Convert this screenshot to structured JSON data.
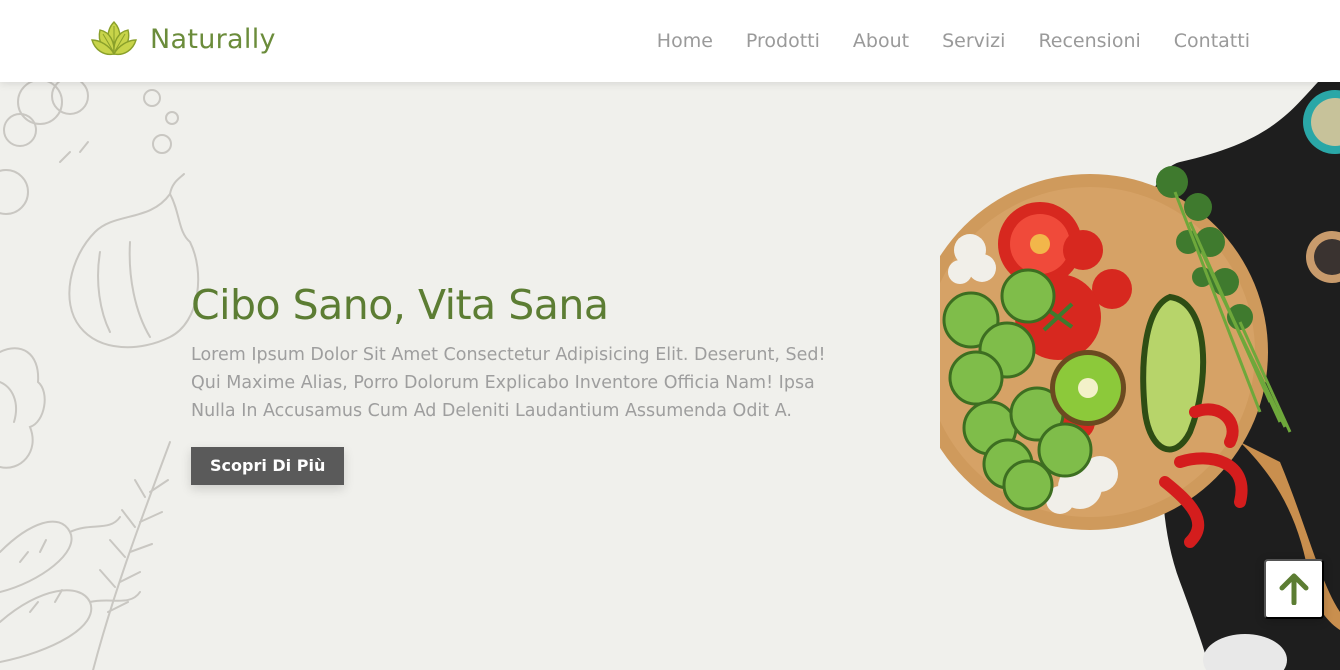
{
  "brand": {
    "name": "Naturally",
    "accent": "#6b8c3b",
    "logo_icon": "leaf-lotus-icon"
  },
  "nav": {
    "items": [
      {
        "label": "Home"
      },
      {
        "label": "Prodotti"
      },
      {
        "label": "About"
      },
      {
        "label": "Servizi"
      },
      {
        "label": "Recensioni"
      },
      {
        "label": "Contatti"
      }
    ]
  },
  "hero": {
    "title": "Cibo Sano, Vita Sana",
    "description": "Lorem Ipsum Dolor Sit Amet Consectetur Adipisicing Elit. Deserunt, Sed! Qui Maxime Alias, Porro Dolorum Explicabo Inventore Officia Nam! Ipsa Nulla In Accusamus Cum Ad Deleniti Laudantium Assumenda Odit A.",
    "cta_label": "Scopri Di Più",
    "title_color": "#5c7d33",
    "button_color": "#5a5a5a"
  },
  "back_to_top": {
    "icon": "arrow-up-icon"
  }
}
